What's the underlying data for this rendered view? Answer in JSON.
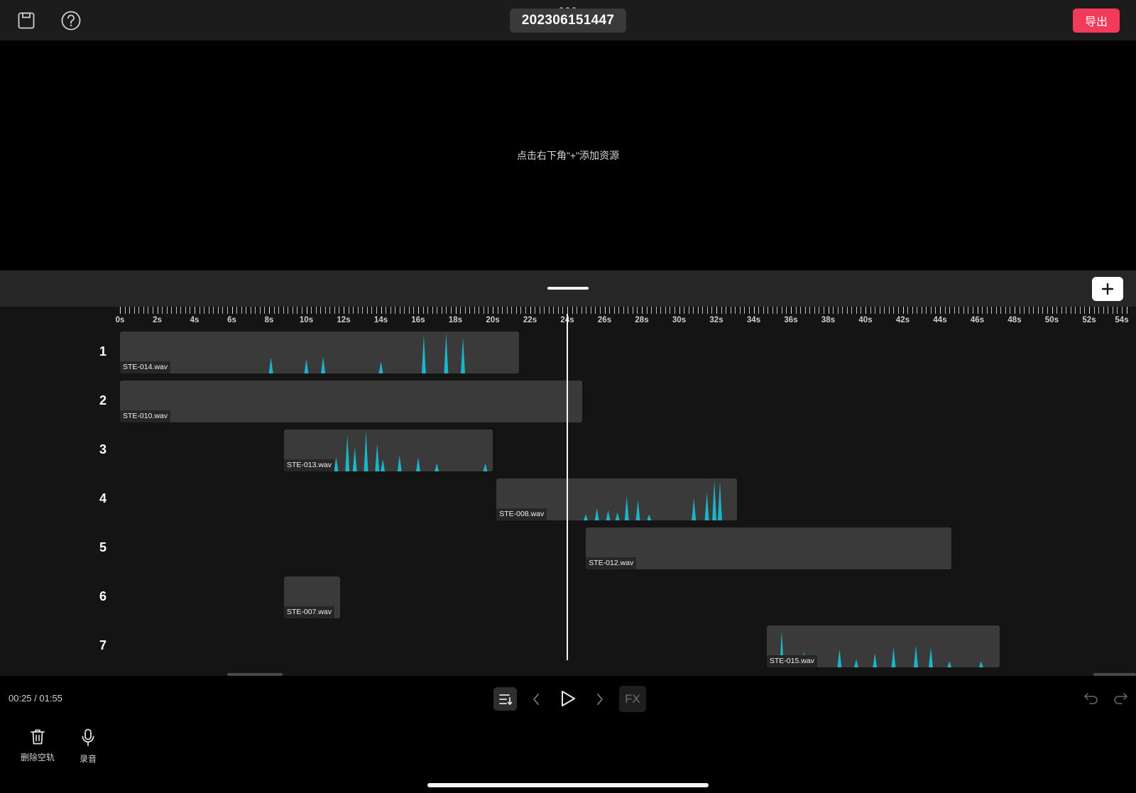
{
  "header": {
    "project_title": "202306151447",
    "export_label": "导出",
    "save_icon": "save-icon",
    "help_icon": "help-icon"
  },
  "preview": {
    "hint": "点击右下角\"+\"添加资源"
  },
  "timeline": {
    "ruler_labels": [
      "0s",
      "2s",
      "4s",
      "6s",
      "8s",
      "10s",
      "12s",
      "14s",
      "16s",
      "18s",
      "20s",
      "22s",
      "24s",
      "26s",
      "28s",
      "30s",
      "32s",
      "34s",
      "36s",
      "38s",
      "40s",
      "42s",
      "44s",
      "46s",
      "48s",
      "50s",
      "52s",
      "54s"
    ],
    "tracks": [
      {
        "number": "1",
        "clip": {
          "name": "STE-014.wav",
          "start_s": 0,
          "end_s": 21.4,
          "peaks": [
            [
              8.1,
              0.4
            ],
            [
              10.0,
              0.35
            ],
            [
              10.9,
              0.42
            ],
            [
              14.0,
              0.3
            ],
            [
              16.3,
              0.95
            ],
            [
              17.5,
              1.0
            ],
            [
              18.4,
              0.9
            ]
          ]
        }
      },
      {
        "number": "2",
        "clip": {
          "name": "STE-010.wav",
          "start_s": 0,
          "end_s": 24.8,
          "peaks": []
        }
      },
      {
        "number": "3",
        "clip": {
          "name": "STE-013.wav",
          "start_s": 8.8,
          "end_s": 20.0,
          "peaks": [
            [
              9.8,
              0.2
            ],
            [
              10.5,
              0.3
            ],
            [
              11.6,
              0.35
            ],
            [
              12.2,
              0.9
            ],
            [
              12.6,
              0.6
            ],
            [
              13.2,
              1.0
            ],
            [
              13.8,
              0.7
            ],
            [
              14.1,
              0.3
            ],
            [
              15.0,
              0.4
            ],
            [
              16.0,
              0.35
            ],
            [
              17.0,
              0.2
            ],
            [
              19.6,
              0.2
            ]
          ]
        }
      },
      {
        "number": "4",
        "clip": {
          "name": "STE-008.wav",
          "start_s": 20.2,
          "end_s": 33.1,
          "peaks": [
            [
              21.0,
              0.15
            ],
            [
              25.0,
              0.15
            ],
            [
              25.6,
              0.3
            ],
            [
              26.2,
              0.25
            ],
            [
              26.7,
              0.2
            ],
            [
              27.2,
              0.6
            ],
            [
              27.8,
              0.5
            ],
            [
              28.4,
              0.15
            ],
            [
              30.8,
              0.55
            ],
            [
              31.5,
              0.7
            ],
            [
              31.9,
              1.0
            ],
            [
              32.2,
              0.95
            ]
          ]
        }
      },
      {
        "number": "5",
        "clip": {
          "name": "STE-012.wav",
          "start_s": 25.0,
          "end_s": 44.6,
          "peaks": []
        }
      },
      {
        "number": "6",
        "clip": {
          "name": "STE-007.wav",
          "start_s": 8.8,
          "end_s": 11.8,
          "peaks": []
        }
      },
      {
        "number": "7",
        "clip": {
          "name": "STE-015.wav",
          "start_s": 34.7,
          "end_s": 47.2,
          "peaks": [
            [
              35.5,
              0.9
            ],
            [
              36.7,
              0.4
            ],
            [
              38.6,
              0.45
            ],
            [
              39.5,
              0.2
            ],
            [
              40.5,
              0.35
            ],
            [
              41.5,
              0.5
            ],
            [
              42.7,
              0.55
            ],
            [
              43.5,
              0.5
            ],
            [
              44.5,
              0.15
            ],
            [
              46.2,
              0.15
            ]
          ]
        }
      }
    ],
    "playhead_s": 24.0
  },
  "controls": {
    "time": "00:25 / 01:55",
    "fx_label": "FX",
    "tools": [
      {
        "label": "删除空轨",
        "icon": "trash-icon"
      },
      {
        "label": "录音",
        "icon": "microphone-icon"
      }
    ]
  },
  "colors": {
    "accent": "#f23a5a",
    "waveform": "#19b5c9",
    "clip": "#3a3a3a",
    "label_bg": "#262626"
  }
}
